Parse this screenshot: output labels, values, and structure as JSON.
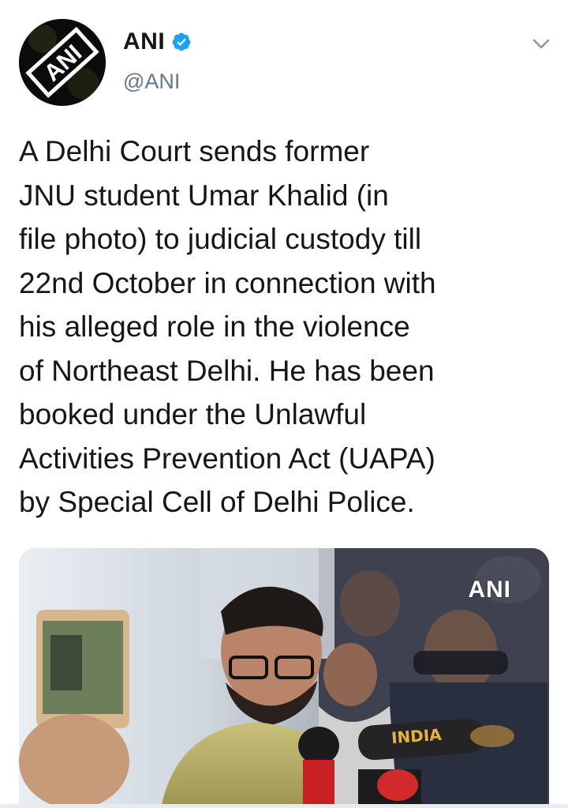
{
  "account": {
    "display_name": "ANI",
    "handle": "@ANI",
    "verified": true,
    "avatar_text": "ANI"
  },
  "tweet": {
    "text_lines": [
      "A Delhi Court sends former",
      "JNU student Umar Khalid (in",
      "file photo) to judicial custody till",
      "22nd October in connection with",
      "his alleged role in the violence",
      "of Northeast Delhi. He has been",
      "booked under the Unlawful",
      "Activities Prevention Act (UAPA)",
      "by Special Cell of Delhi Police."
    ]
  },
  "media": {
    "watermark": "ANI",
    "mic_label": "INDIA"
  },
  "icons": {
    "verified": "verified-badge-icon",
    "menu": "chevron-down-icon"
  },
  "colors": {
    "text_primary": "#14171a",
    "text_secondary": "#657786",
    "verified_blue": "#1da1f2"
  }
}
